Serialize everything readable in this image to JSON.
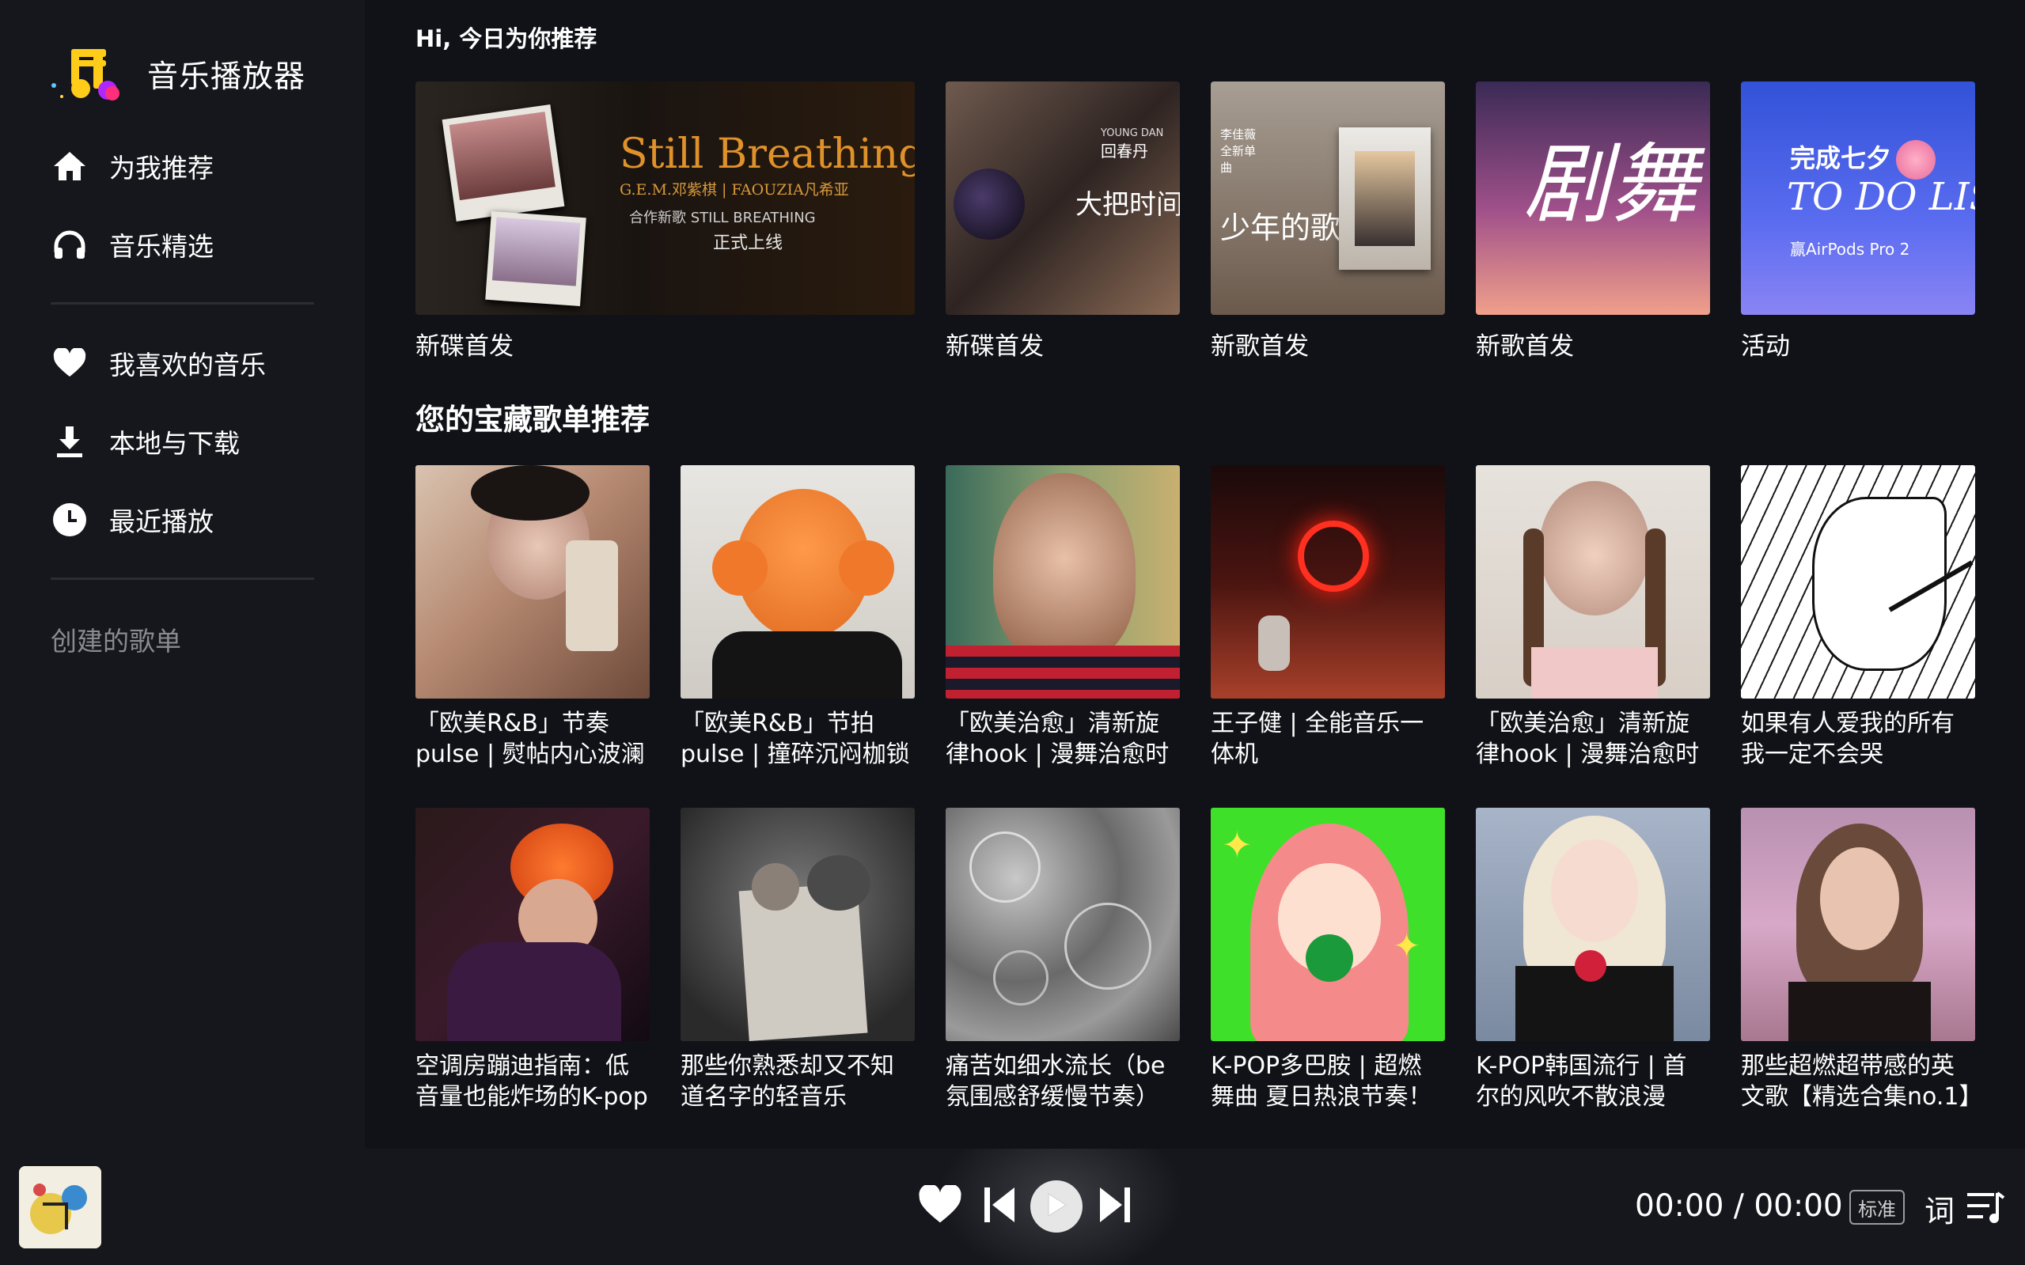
{
  "app": {
    "title": "音乐播放器"
  },
  "sidebar": {
    "items": [
      {
        "label": "为我推荐",
        "icon": "home-icon"
      },
      {
        "label": "音乐精选",
        "icon": "headphones-icon"
      },
      {
        "label": "我喜欢的音乐",
        "icon": "heart-icon"
      },
      {
        "label": "本地与下载",
        "icon": "download-icon"
      },
      {
        "label": "最近播放",
        "icon": "clock-icon"
      }
    ],
    "created_playlists_label": "创建的歌单"
  },
  "main": {
    "greeting": "Hi, 今日为你推荐",
    "banners": [
      {
        "label": "新碟首发",
        "art_title": "Still Breathing",
        "art_sub": "G.E.M.邓紫棋 | FAOUZIA凡希亚",
        "art_tag": "合作新歌 STILL BREATHING",
        "art_tag2": "正式上线"
      },
      {
        "label": "新碟首发",
        "art_title": "大把时间璀璨",
        "art_sub": "回春丹",
        "art_tag": "YOUNG DAN"
      },
      {
        "label": "新歌首发",
        "art_title": "少年的歌",
        "art_sub": "李佳薇 全新单曲"
      },
      {
        "label": "新歌首发",
        "art_title": "剧舞",
        "art_sub": ""
      },
      {
        "label": "活动",
        "art_title": "TO DO LIST",
        "art_sub": "完成七夕",
        "art_tag": "赢AirPods Pro 2"
      }
    ],
    "section_title": "您的宝藏歌单推荐",
    "playlists": [
      {
        "title": "「欧美R&B」节奏pulse | 熨帖内心波澜"
      },
      {
        "title": "「欧美R&B」节拍pulse | 撞碎沉闷枷锁"
      },
      {
        "title": "「欧美治愈」清新旋律hook | 漫舞治愈时光"
      },
      {
        "title": "王子健 | 全能音乐一体机"
      },
      {
        "title": "「欧美治愈」清新旋律hook | 漫舞治愈时光"
      },
      {
        "title": "如果有人爱我的所有我一定不会哭"
      },
      {
        "title": "空调房蹦迪指南：低音量也能炸场的K-pop"
      },
      {
        "title": "那些你熟悉却又不知道名字的轻音乐"
      },
      {
        "title": "痛苦如细水流长（be氛围感舒缓慢节奏）"
      },
      {
        "title": "K-POP多巴胺 | 超燃舞曲 夏日热浪节奏！"
      },
      {
        "title": "K-POP韩国流行 | 首尔的风吹不散浪漫"
      },
      {
        "title": "那些超燃超带感的英文歌【精选合集no.1】"
      }
    ]
  },
  "player": {
    "time": "00:00 / 00:00",
    "quality": "标准",
    "lyrics_label": "词",
    "controls": [
      "heart-icon",
      "previous-icon",
      "play-icon",
      "next-icon",
      "queue-icon"
    ]
  },
  "colors": {
    "background": "#111217",
    "sidebar": "#16171c",
    "text": "#ffffff",
    "muted": "#8a8b90"
  }
}
